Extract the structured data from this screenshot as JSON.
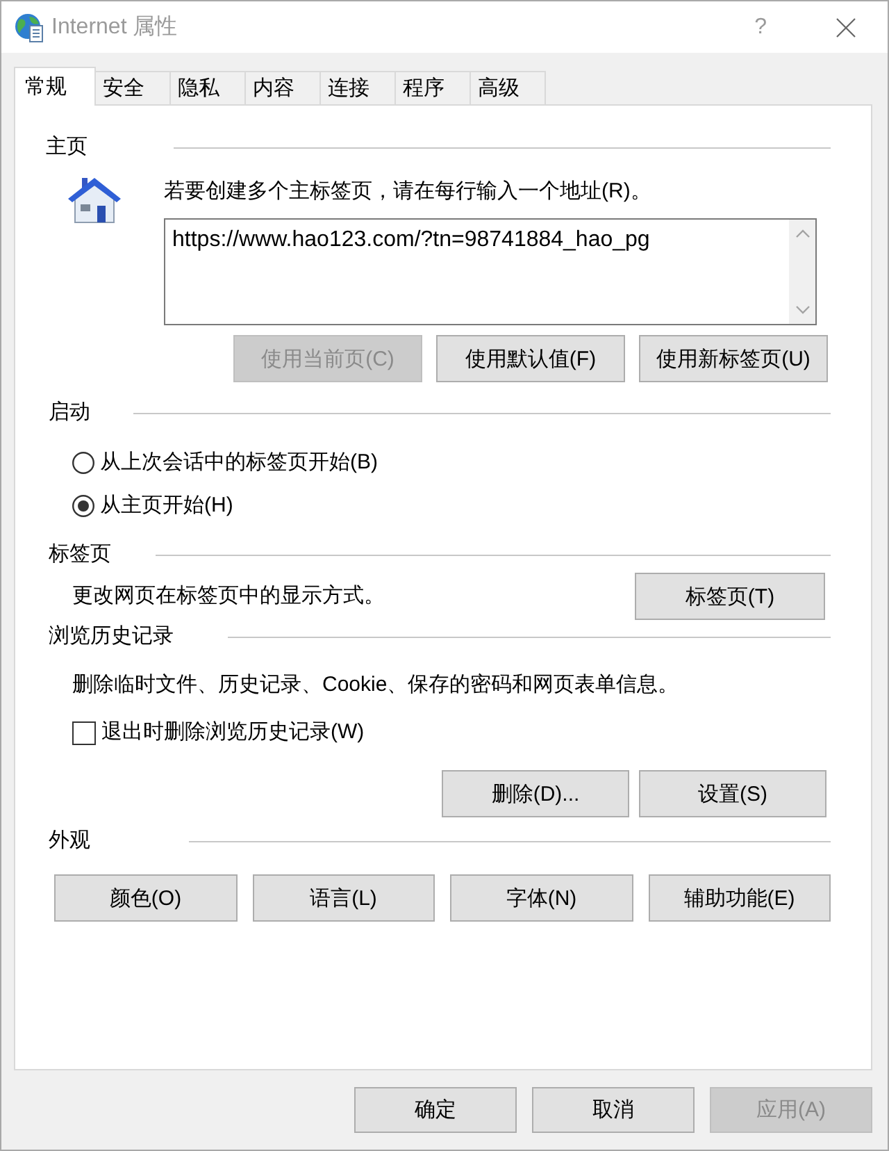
{
  "window": {
    "title": "Internet 属性",
    "help_button": "?"
  },
  "tabs": [
    {
      "label": "常规",
      "selected": true
    },
    {
      "label": "安全",
      "selected": false
    },
    {
      "label": "隐私",
      "selected": false
    },
    {
      "label": "内容",
      "selected": false
    },
    {
      "label": "连接",
      "selected": false
    },
    {
      "label": "程序",
      "selected": false
    },
    {
      "label": "高级",
      "selected": false
    }
  ],
  "sections": [
    {
      "kind": "homepage",
      "title": "主页",
      "instruction": "若要创建多个主标签页，请在每行输入一个地址(R)。",
      "addresses": "https://www.hao123.com/?tn=98741884_hao_pg",
      "buttons": [
        {
          "label": "使用当前页(C)",
          "disabled": true
        },
        {
          "label": "使用默认值(F)",
          "disabled": false
        },
        {
          "label": "使用新标签页(U)",
          "disabled": false
        }
      ]
    },
    {
      "kind": "startup",
      "title": "启动",
      "options": [
        {
          "label": "从上次会话中的标签页开始(B)",
          "selected": false
        },
        {
          "label": "从主页开始(H)",
          "selected": true
        }
      ]
    },
    {
      "kind": "tabs",
      "title": "标签页",
      "description": "更改网页在标签页中的显示方式。",
      "buttons": [
        {
          "label": "标签页(T)",
          "disabled": false
        }
      ]
    },
    {
      "kind": "history",
      "title": "浏览历史记录",
      "description": "删除临时文件、历史记录、Cookie、保存的密码和网页表单信息。",
      "checkbox": {
        "label": "退出时删除浏览历史记录(W)",
        "checked": false
      },
      "buttons": [
        {
          "label": "删除(D)...",
          "disabled": false
        },
        {
          "label": "设置(S)",
          "disabled": false
        }
      ]
    },
    {
      "kind": "appearance",
      "title": "外观",
      "buttons": [
        {
          "label": "颜色(O)",
          "disabled": false
        },
        {
          "label": "语言(L)",
          "disabled": false
        },
        {
          "label": "字体(N)",
          "disabled": false
        },
        {
          "label": "辅助功能(E)",
          "disabled": false
        }
      ]
    }
  ],
  "footer_buttons": [
    {
      "label": "确定",
      "disabled": false
    },
    {
      "label": "取消",
      "disabled": false
    },
    {
      "label": "应用(A)",
      "disabled": true
    }
  ]
}
